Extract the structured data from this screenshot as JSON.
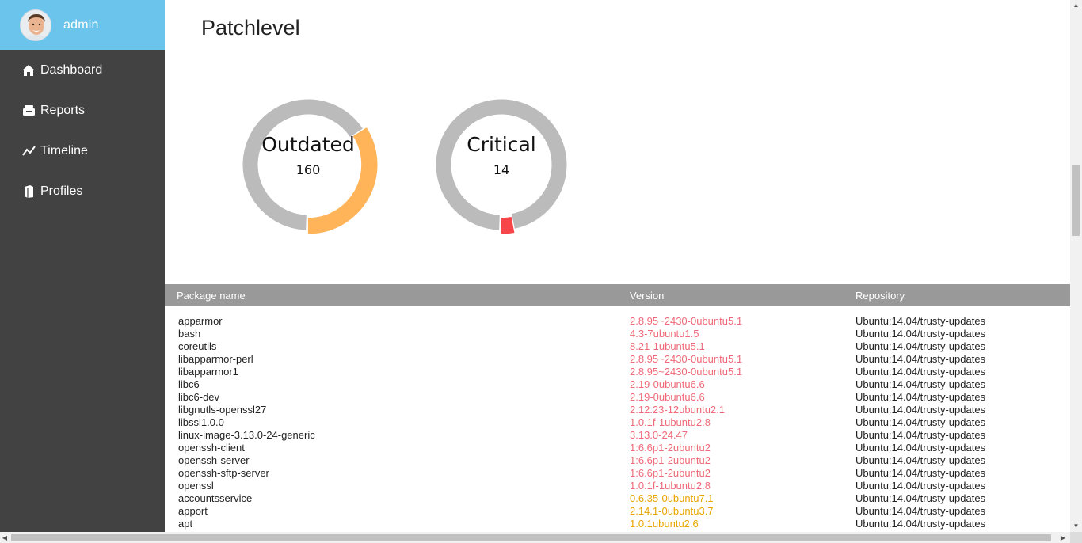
{
  "sidebar": {
    "user": {
      "name": "admin"
    },
    "items": [
      {
        "label": "Dashboard",
        "icon": "home-icon"
      },
      {
        "label": "Reports",
        "icon": "inbox-icon"
      },
      {
        "label": "Timeline",
        "icon": "trend-line-icon"
      },
      {
        "label": "Profiles",
        "icon": "book-icon"
      }
    ]
  },
  "page": {
    "title": "Patchlevel"
  },
  "gauges": [
    {
      "label": "Outdated",
      "value": "160",
      "fraction": 0.34,
      "color": "#ffb459",
      "track": "#bbbbbb"
    },
    {
      "label": "Critical",
      "value": "14",
      "fraction": 0.03,
      "color": "#f7464a",
      "track": "#bbbbbb"
    }
  ],
  "table": {
    "columns": {
      "name": "Package name",
      "version": "Version",
      "repository": "Repository"
    },
    "rows": [
      {
        "name": "apparmor",
        "version": "2.8.95~2430-0ubuntu5.1",
        "repository": "Ubuntu:14.04/trusty-updates",
        "severity": "critical"
      },
      {
        "name": "bash",
        "version": "4.3-7ubuntu1.5",
        "repository": "Ubuntu:14.04/trusty-updates",
        "severity": "critical"
      },
      {
        "name": "coreutils",
        "version": "8.21-1ubuntu5.1",
        "repository": "Ubuntu:14.04/trusty-updates",
        "severity": "critical"
      },
      {
        "name": "libapparmor-perl",
        "version": "2.8.95~2430-0ubuntu5.1",
        "repository": "Ubuntu:14.04/trusty-updates",
        "severity": "critical"
      },
      {
        "name": "libapparmor1",
        "version": "2.8.95~2430-0ubuntu5.1",
        "repository": "Ubuntu:14.04/trusty-updates",
        "severity": "critical"
      },
      {
        "name": "libc6",
        "version": "2.19-0ubuntu6.6",
        "repository": "Ubuntu:14.04/trusty-updates",
        "severity": "critical"
      },
      {
        "name": "libc6-dev",
        "version": "2.19-0ubuntu6.6",
        "repository": "Ubuntu:14.04/trusty-updates",
        "severity": "critical"
      },
      {
        "name": "libgnutls-openssl27",
        "version": "2.12.23-12ubuntu2.1",
        "repository": "Ubuntu:14.04/trusty-updates",
        "severity": "critical"
      },
      {
        "name": "libssl1.0.0",
        "version": "1.0.1f-1ubuntu2.8",
        "repository": "Ubuntu:14.04/trusty-updates",
        "severity": "critical"
      },
      {
        "name": "linux-image-3.13.0-24-generic",
        "version": "3.13.0-24.47",
        "repository": "Ubuntu:14.04/trusty-updates",
        "severity": "critical"
      },
      {
        "name": "openssh-client",
        "version": "1:6.6p1-2ubuntu2",
        "repository": "Ubuntu:14.04/trusty-updates",
        "severity": "critical"
      },
      {
        "name": "openssh-server",
        "version": "1:6.6p1-2ubuntu2",
        "repository": "Ubuntu:14.04/trusty-updates",
        "severity": "critical"
      },
      {
        "name": "openssh-sftp-server",
        "version": "1:6.6p1-2ubuntu2",
        "repository": "Ubuntu:14.04/trusty-updates",
        "severity": "critical"
      },
      {
        "name": "openssl",
        "version": "1.0.1f-1ubuntu2.8",
        "repository": "Ubuntu:14.04/trusty-updates",
        "severity": "critical"
      },
      {
        "name": "accountsservice",
        "version": "0.6.35-0ubuntu7.1",
        "repository": "Ubuntu:14.04/trusty-updates",
        "severity": "outdated"
      },
      {
        "name": "apport",
        "version": "2.14.1-0ubuntu3.7",
        "repository": "Ubuntu:14.04/trusty-updates",
        "severity": "outdated"
      },
      {
        "name": "apt",
        "version": "1.0.1ubuntu2.6",
        "repository": "Ubuntu:14.04/trusty-updates",
        "severity": "outdated"
      }
    ]
  }
}
